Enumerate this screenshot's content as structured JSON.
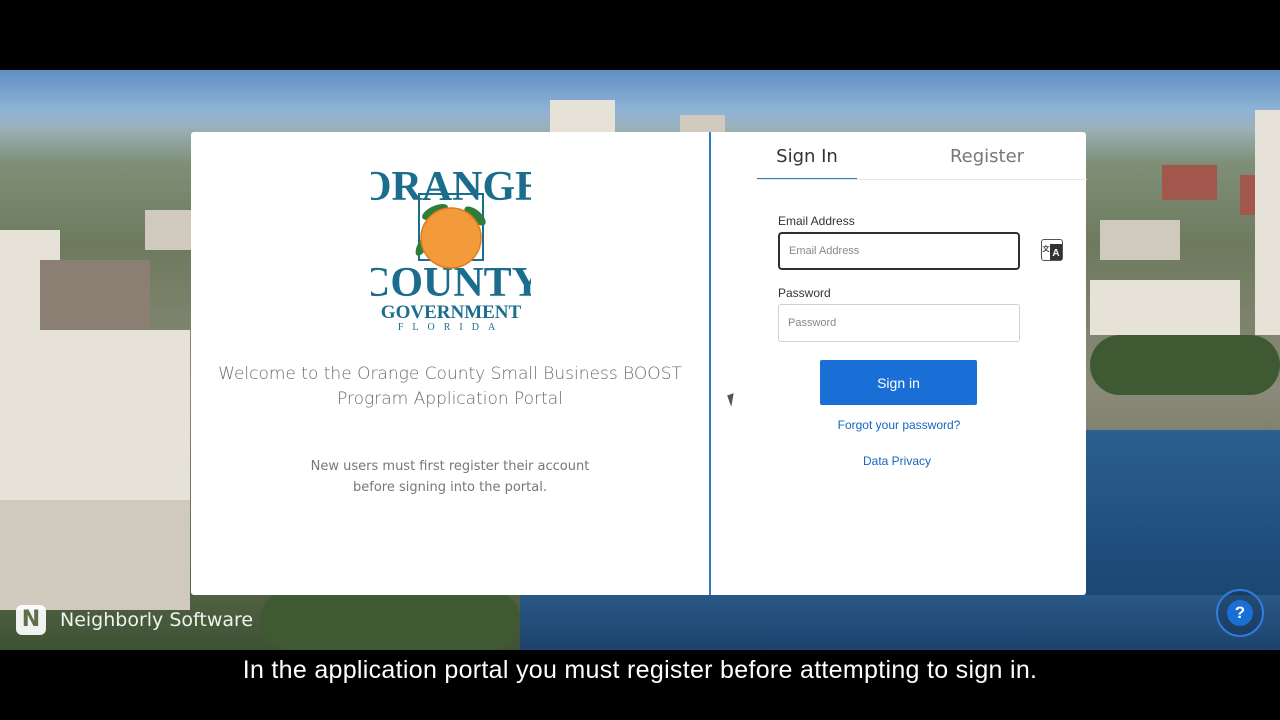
{
  "logo": {
    "line1": "ORANGE",
    "line2": "COUNTY",
    "line3": "GOVERNMENT",
    "line4": "FLORIDA",
    "fruit_color": "#f39a3b",
    "text_color": "#1b6d8e",
    "leaf_color": "#2f7d3a"
  },
  "welcome": {
    "line1": "Welcome to the Orange County Small Business BOOST",
    "line2": "Program Application Portal"
  },
  "note": {
    "line1": "New users must first register their account",
    "line2": "before signing into the portal."
  },
  "tabs": {
    "sign_in": "Sign In",
    "register": "Register"
  },
  "form": {
    "email_label": "Email Address",
    "email_placeholder": "Email Address",
    "email_value": "",
    "password_label": "Password",
    "password_placeholder": "Password",
    "password_value": "",
    "submit_label": "Sign in",
    "forgot_label": "Forgot your password?",
    "privacy_label": "Data Privacy",
    "translate_icon": "translate-icon"
  },
  "brand": {
    "mark": "N",
    "name": "Neighborly Software"
  },
  "help": {
    "label": "?"
  },
  "caption": "In the application portal you must register before attempting to sign in.",
  "colors": {
    "accent": "#2c7dc5",
    "button": "#1a6fd6",
    "link": "#1565c0"
  }
}
